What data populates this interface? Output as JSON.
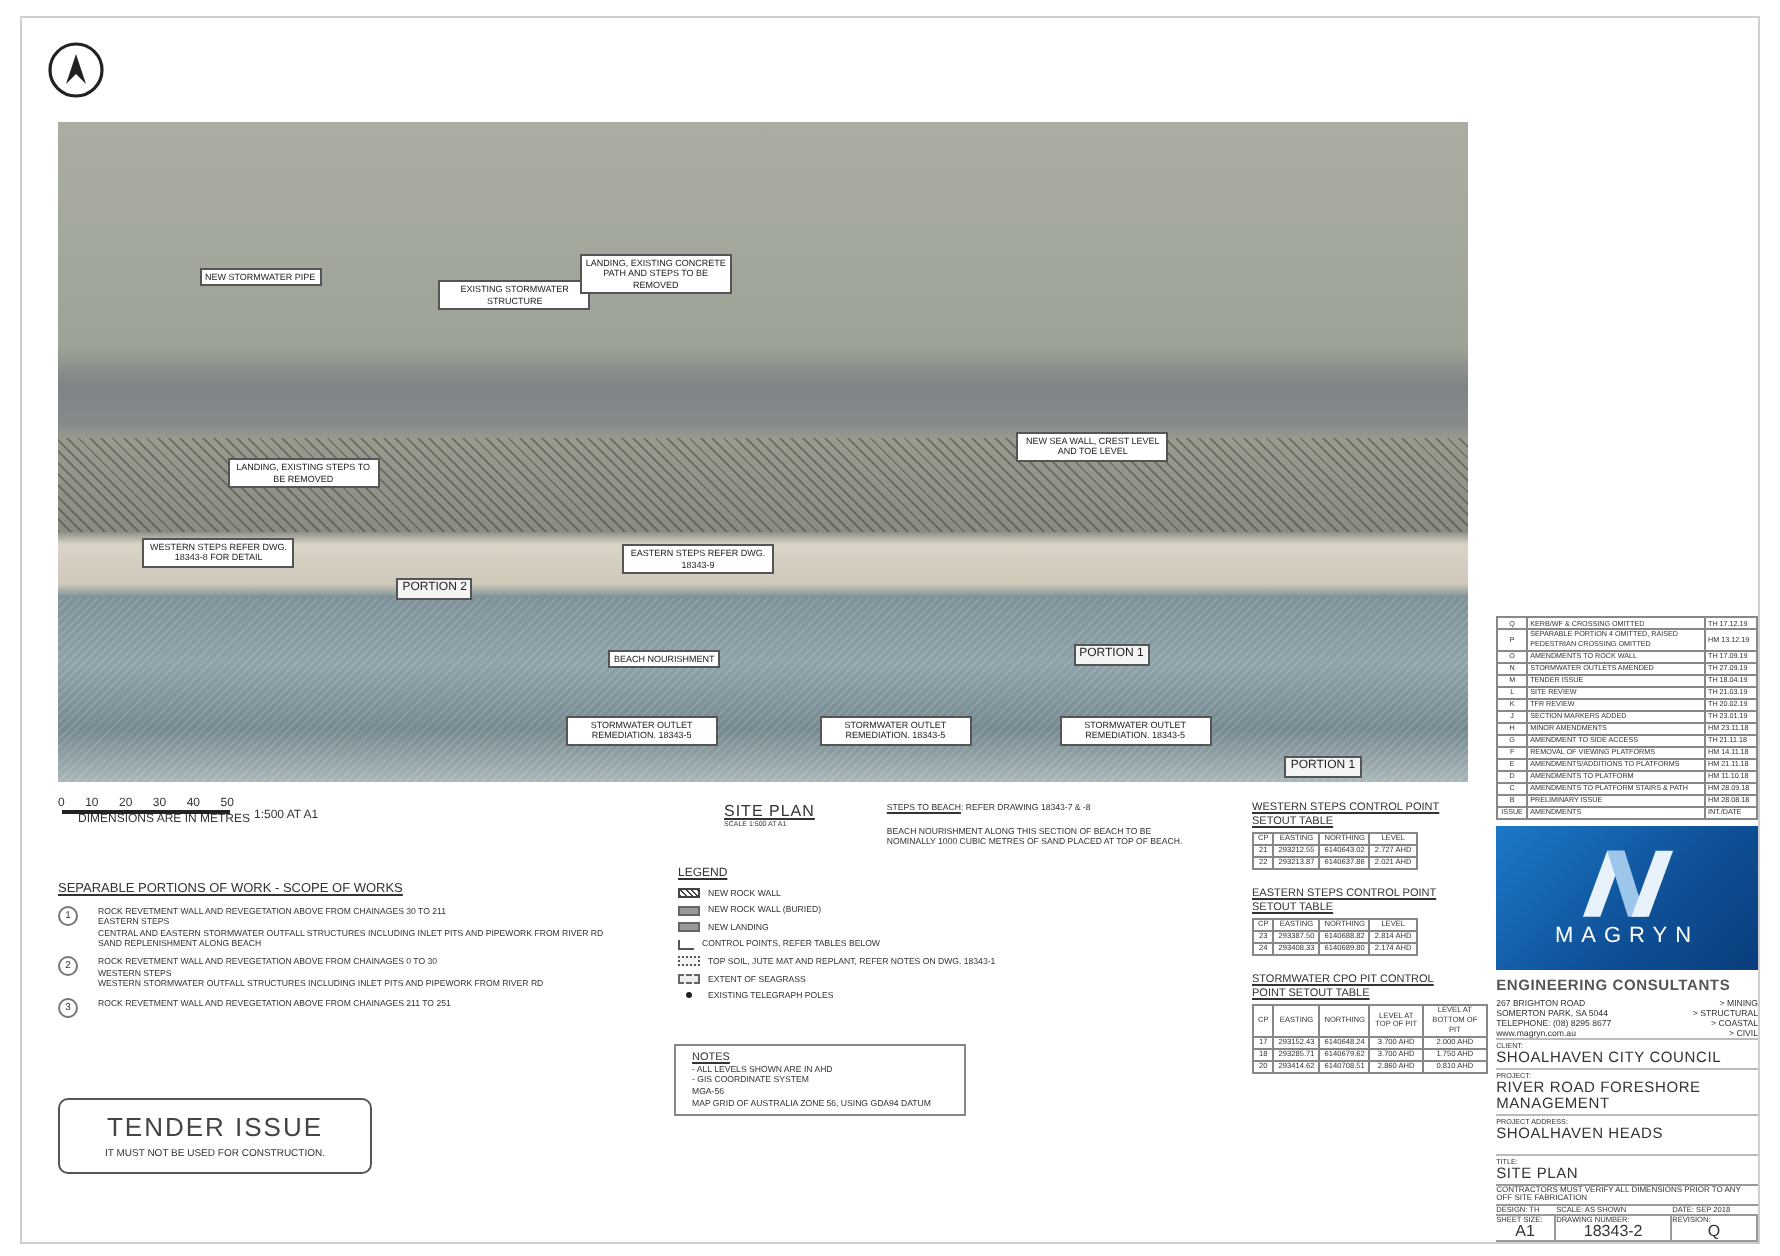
{
  "plan_labels": [
    {
      "kind": "callout",
      "text": "NEW STORMWATER PIPE"
    },
    {
      "kind": "callout",
      "text": "EXISTING STORMWATER STRUCTURE"
    },
    {
      "kind": "callout",
      "text": "LANDING, EXISTING CONCRETE PATH AND STEPS TO BE REMOVED"
    },
    {
      "kind": "callout",
      "text": "LANDING, EXISTING STEPS TO BE REMOVED"
    },
    {
      "kind": "callout",
      "text": "WESTERN STEPS REFER DWG. 18343-8 FOR DETAIL"
    },
    {
      "kind": "portion",
      "text": "PORTION 2"
    },
    {
      "kind": "callout",
      "text": "EASTERN STEPS REFER DWG. 18343-9"
    },
    {
      "kind": "callout",
      "text": "BEACH NOURISHMENT"
    },
    {
      "kind": "callout",
      "text": "STORMWATER OUTLET REMEDIATION. 18343-5"
    },
    {
      "kind": "callout",
      "text": "STORMWATER OUTLET REMEDIATION. 18343-5"
    },
    {
      "kind": "callout",
      "text": "STORMWATER OUTLET REMEDIATION. 18343-5"
    },
    {
      "kind": "callout",
      "text": "NEW SEA WALL, CREST LEVEL AND TOE LEVEL"
    },
    {
      "kind": "portion",
      "text": "PORTION 1"
    },
    {
      "kind": "portion",
      "text": "PORTION 1"
    }
  ],
  "scale_bar": {
    "ticks": [
      "0",
      "10",
      "20",
      "30",
      "40",
      "50"
    ],
    "caption": "DIMENSIONS ARE IN METRES",
    "ratio": "1:500 AT A1"
  },
  "scope": {
    "heading": "SEPARABLE PORTIONS OF WORK - SCOPE OF WORKS",
    "items": [
      {
        "number": "1",
        "lines": [
          "ROCK REVETMENT WALL AND REVEGETATION ABOVE FROM CHAINAGES 30 TO 211",
          "EASTERN STEPS",
          "CENTRAL AND EASTERN STORMWATER OUTFALL STRUCTURES INCLUDING INLET PITS AND PIPEWORK FROM RIVER RD",
          "SAND REPLENISHMENT ALONG BEACH"
        ]
      },
      {
        "number": "2",
        "lines": [
          "ROCK REVETMENT WALL AND REVEGETATION ABOVE FROM CHAINAGES 0 TO 30",
          "WESTERN STEPS",
          "WESTERN STORMWATER OUTFALL STRUCTURES INCLUDING INLET PITS AND PIPEWORK FROM RIVER RD"
        ]
      },
      {
        "number": "3",
        "lines": [
          "ROCK REVETMENT WALL AND REVEGETATION ABOVE FROM CHAINAGES 211 TO 251"
        ]
      }
    ]
  },
  "tender": {
    "title": "TENDER ISSUE",
    "note": "IT MUST NOT BE USED FOR CONSTRUCTION."
  },
  "site_plan": {
    "title": "SITE PLAN",
    "scale": "SCALE 1:500 AT A1",
    "steps_label": "STEPS TO BEACH",
    "steps_text": ": REFER DRAWING 18343-7 & -8",
    "nourishment": "BEACH NOURISHMENT ALONG THIS SECTION OF BEACH TO BE NOMINALLY 1000 CUBIC METRES OF SAND PLACED AT TOP OF BEACH."
  },
  "legend": {
    "heading": "LEGEND",
    "items": [
      {
        "kind": "rock-wall",
        "text": "NEW ROCK WALL"
      },
      {
        "kind": "buried",
        "text": "NEW ROCK WALL (BURIED)"
      },
      {
        "kind": "landing",
        "text": "NEW LANDING"
      },
      {
        "kind": "control",
        "text": "CONTROL POINTS, REFER TABLES BELOW"
      },
      {
        "kind": "topsoil",
        "text": "TOP SOIL, JUTE MAT AND REPLANT, REFER NOTES ON DWG. 18343-1"
      },
      {
        "kind": "seagrass",
        "text": "EXTENT OF SEAGRASS"
      },
      {
        "kind": "pole",
        "text": "EXISTING TELEGRAPH POLES"
      }
    ]
  },
  "notes": {
    "heading": "NOTES",
    "lines": [
      "- ALL LEVELS SHOWN ARE IN AHD",
      "- GIS COORDINATE SYSTEM",
      "MGA-56",
      "MAP GRID OF AUSTRALIA ZONE 56, USING GDA94 DATUM"
    ]
  },
  "tables": [
    {
      "title": "WESTERN STEPS CONTROL POINT SETOUT TABLE",
      "columns": [
        "CP",
        "EASTING",
        "NORTHING",
        "LEVEL"
      ],
      "rows": [
        [
          "21",
          "293212.55",
          "6140643.02",
          "2.727 AHD"
        ],
        [
          "22",
          "293213.87",
          "6140637.86",
          "2.021 AHD"
        ]
      ]
    },
    {
      "title": "EASTERN STEPS CONTROL POINT SETOUT TABLE",
      "columns": [
        "CP",
        "EASTING",
        "NORTHING",
        "LEVEL"
      ],
      "rows": [
        [
          "23",
          "293387.50",
          "6140688.82",
          "2.814 AHD"
        ],
        [
          "24",
          "293408.33",
          "6140689.80",
          "2.174 AHD"
        ]
      ]
    },
    {
      "title": "STORMWATER CPO PIT CONTROL POINT SETOUT TABLE",
      "columns": [
        "CP",
        "EASTING",
        "NORTHING",
        "LEVEL AT TOP OF PIT",
        "LEVEL AT BOTTOM OF PIT"
      ],
      "rows": [
        [
          "17",
          "293152.43",
          "6140648.24",
          "3.700 AHD",
          "2.000 AHD"
        ],
        [
          "18",
          "293285.71",
          "6140679.62",
          "3.700 AHD",
          "1.750 AHD"
        ],
        [
          "20",
          "293414.62",
          "6140708.51",
          "2.860 AHD",
          "0.810 AHD"
        ]
      ]
    }
  ],
  "revisions": {
    "rows": [
      [
        "Q",
        "KERB/WF & CROSSING OMITTED",
        "TH 17.12.19"
      ],
      [
        "P",
        "SEPARABLE PORTION 4 OMITTED, RAISED PEDESTRIAN CROSSING OMITTED",
        "HM 13.12.19"
      ],
      [
        "O",
        "AMENDMENTS TO ROCK WALL",
        "TH 17.09.19"
      ],
      [
        "N",
        "STORMWATER OUTLETS AMENDED",
        "TH 27.09.19"
      ],
      [
        "M",
        "TENDER ISSUE",
        "TH 18.04.19"
      ],
      [
        "L",
        "SITE REVIEW",
        "TH 21.03.19"
      ],
      [
        "K",
        "TFR REVIEW",
        "TH 20.02.19"
      ],
      [
        "J",
        "SECTION MARKERS ADDED",
        "TH 23.01.19"
      ],
      [
        "H",
        "MINOR AMENDMENTS",
        "HM 23.11.18"
      ],
      [
        "G",
        "AMENDMENT TO SIDE ACCESS",
        "TH 21.11.18"
      ],
      [
        "F",
        "REMOVAL OF VIEWING PLATFORMS",
        "HM 14.11.18"
      ],
      [
        "E",
        "AMENDMENTS/ADDITIONS TO PLATFORMS",
        "HM 21.11.18"
      ],
      [
        "D",
        "AMENDMENTS TO PLATFORM",
        "HM 11.10.18"
      ],
      [
        "C",
        "AMENDMENTS TO PLATFORM STAIRS & PATH",
        "HM 28.09.18"
      ],
      [
        "B",
        "PRELIMINARY ISSUE",
        "HM 28.08.18"
      ],
      [
        "ISSUE",
        "AMENDMENTS",
        "INT./DATE"
      ]
    ]
  },
  "company": {
    "logo_text": "MAGRYN",
    "name": "ENGINEERING CONSULTANTS",
    "address": [
      "267 BRIGHTON ROAD",
      "SOMERTON PARK, SA 5044",
      "TELEPHONE: (08) 8295 8677",
      "www.magryn.com.au"
    ],
    "services": [
      "> MINING",
      "> STRUCTURAL",
      "> COASTAL",
      "> CIVIL"
    ]
  },
  "client": {
    "label": "CLIENT:",
    "value": "SHOALHAVEN CITY COUNCIL"
  },
  "project": {
    "label": "PROJECT:",
    "value": "RIVER ROAD FORESHORE MANAGEMENT"
  },
  "project_address": {
    "label": "PROJECT ADDRESS:",
    "value": "SHOALHAVEN HEADS"
  },
  "title_block": {
    "label": "TITLE:",
    "value": "SITE PLAN",
    "contractor_note": "CONTRACTORS MUST VERIFY ALL DIMENSIONS PRIOR TO ANY OFF SITE FABRICATION",
    "design": "DESIGN: TH",
    "scale": "SCALE: AS SHOWN",
    "date": "DATE: SEP 2018",
    "sheet_size_label": "SHEET SIZE:",
    "sheet_size": "A1",
    "drawing_number_label": "DRAWING NUMBER:",
    "drawing_number": "18343-2",
    "revision_label": "REVISION:",
    "revision": "Q"
  }
}
